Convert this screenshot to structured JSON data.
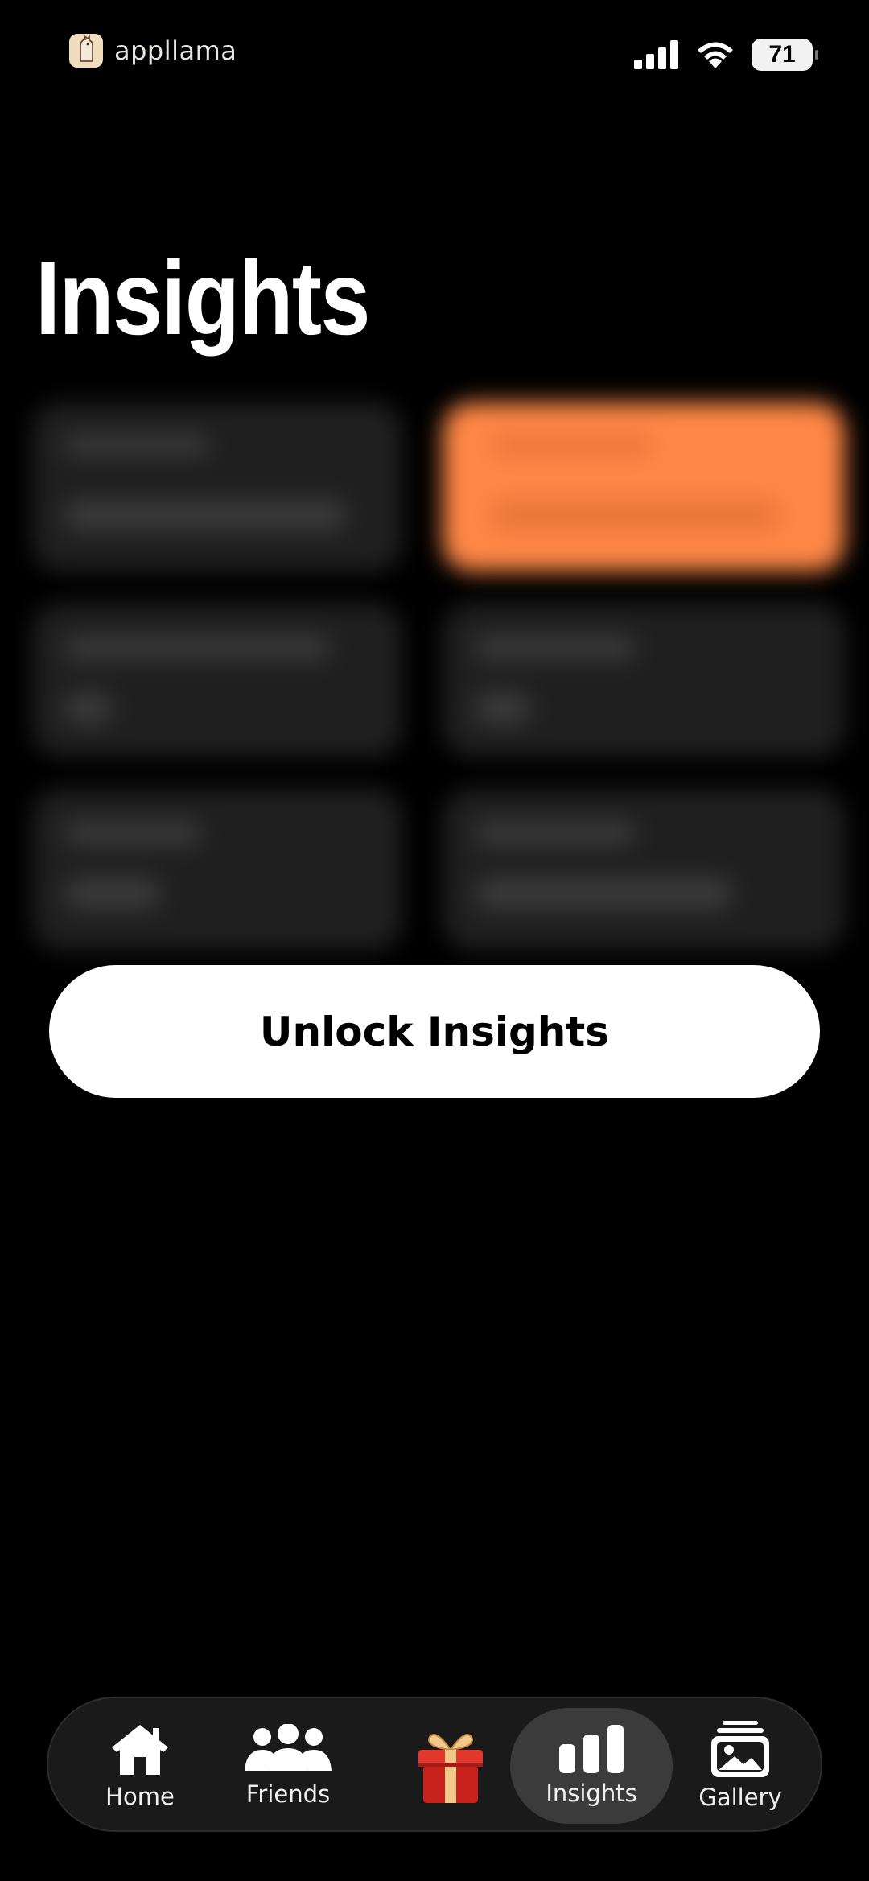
{
  "status_bar": {
    "brand_name": "appllama",
    "battery_level": "71",
    "icons": [
      "signal-icon",
      "wifi-icon",
      "battery-icon"
    ]
  },
  "page": {
    "title": "Insights"
  },
  "unlock_button": {
    "label": "Unlock Insights"
  },
  "tab_bar": {
    "items": [
      {
        "label": "Home",
        "icon": "home-icon"
      },
      {
        "label": "Friends",
        "icon": "friends-icon"
      },
      {
        "label": "",
        "icon": "gift-icon"
      },
      {
        "label": "Insights",
        "icon": "bar-chart-icon",
        "active": true
      },
      {
        "label": "Gallery",
        "icon": "gallery-icon"
      }
    ]
  },
  "colors": {
    "background": "#000000",
    "accent": "#ff8746",
    "card": "#1f1f1f",
    "button": "#ffffff"
  }
}
